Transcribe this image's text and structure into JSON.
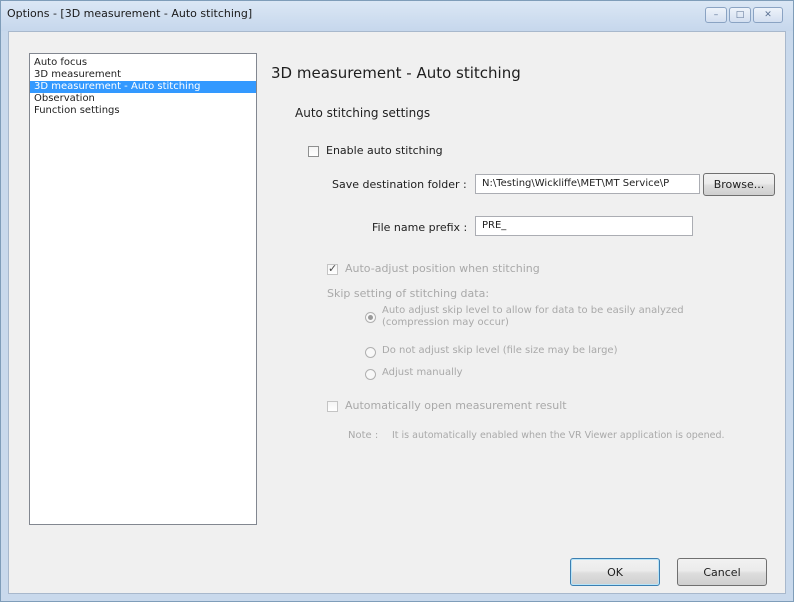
{
  "window": {
    "title": "Options - [3D measurement - Auto stitching]",
    "controls": {
      "minimize": "–",
      "maximize": "□",
      "close": "✕"
    }
  },
  "sidebar": {
    "items": [
      {
        "label": "Auto focus",
        "selected": false
      },
      {
        "label": "3D measurement",
        "selected": false
      },
      {
        "label": "3D measurement - Auto stitching",
        "selected": true
      },
      {
        "label": "Observation",
        "selected": false
      },
      {
        "label": "Function settings",
        "selected": false
      }
    ]
  },
  "panel": {
    "heading": "3D measurement - Auto stitching",
    "section_label": "Auto stitching settings",
    "enable_auto_stitching": {
      "label": "Enable auto stitching",
      "checked": false
    },
    "save_folder": {
      "label": "Save destination folder :",
      "value": "N:\\Testing\\Wickliffe\\MET\\MT Service\\P",
      "browse_label": "Browse..."
    },
    "file_prefix": {
      "label": "File name prefix :",
      "value": "PRE_"
    },
    "auto_adjust_position": {
      "label": "Auto-adjust position when stitching",
      "checked": true
    },
    "skip_setting_label": "Skip setting of stitching data:",
    "skip_options": [
      {
        "label": "Auto adjust skip level to allow for data to be easily analyzed",
        "label2": "(compression may occur)",
        "checked": true
      },
      {
        "label": "Do not adjust skip level (file size may be large)",
        "checked": false
      },
      {
        "label": "Adjust manually",
        "checked": false
      }
    ],
    "auto_open_result": {
      "label": "Automatically open measurement result",
      "checked": false
    },
    "note": {
      "prefix": "Note :",
      "text": "It is automatically enabled when the VR Viewer application is opened."
    }
  },
  "footer": {
    "ok_label": "OK",
    "cancel_label": "Cancel"
  },
  "colors": {
    "selection": "#3399ff",
    "disabled_text": "#a9a9a9",
    "frame": "#c9d9ec"
  }
}
